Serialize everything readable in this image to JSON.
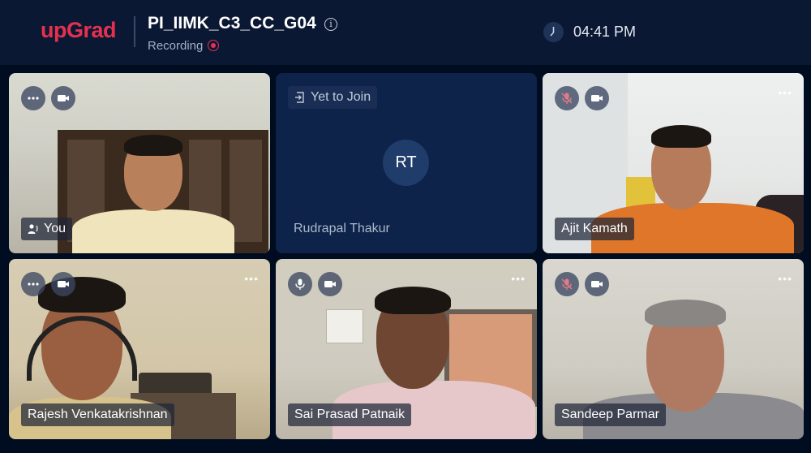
{
  "header": {
    "logo": "upGrad",
    "meeting_title": "PI_IIMK_C3_CC_G04",
    "recording_label": "Recording",
    "time": "04:41 PM"
  },
  "participants": [
    {
      "name": "You"
    },
    {
      "name": "Rudrapal Thakur",
      "status": "Yet to Join",
      "initials": "RT"
    },
    {
      "name": "Ajit Kamath"
    },
    {
      "name": "Rajesh Venkatakrishnan"
    },
    {
      "name": "Sai Prasad Patnaik"
    },
    {
      "name": "Sandeep Parmar"
    }
  ],
  "colors": {
    "brand": "#e5314f",
    "header_bg": "#0b1833",
    "page_bg": "#000c20",
    "pending_tile_bg": "#0d2349"
  }
}
